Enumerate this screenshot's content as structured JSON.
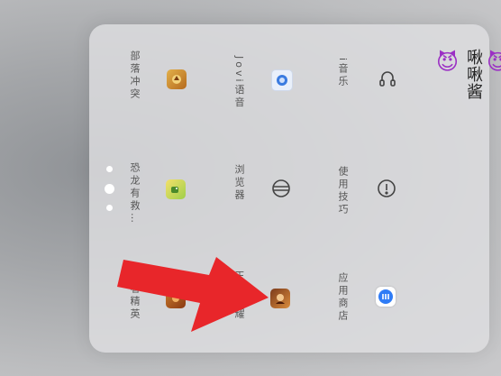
{
  "folder": {
    "title_emoji_left": "😈",
    "title_text": "啾啾酱",
    "title_emoji_right": "😈"
  },
  "apps": [
    {
      "label": "i音乐",
      "icon": "headphones-icon"
    },
    {
      "label": "Jovi语音",
      "icon": "jovi-voice-icon"
    },
    {
      "label": "部落冲突",
      "icon": "clash-of-clans-icon"
    },
    {
      "label": "使用技巧",
      "icon": "tips-icon"
    },
    {
      "label": "浏览器",
      "icon": "browser-icon"
    },
    {
      "label": "恐龙有救…",
      "icon": "dino-game-icon"
    },
    {
      "label": "应用商店",
      "icon": "app-store-icon"
    },
    {
      "label": "王者荣耀",
      "icon": "honor-of-kings-icon"
    },
    {
      "label": "王者精英",
      "icon": "game-icon"
    }
  ],
  "page_indicator": {
    "pages": 3,
    "current": 2
  },
  "colors": {
    "arrow": "#e8262a",
    "panel": "#dedee0",
    "app_store_blue": "#2f7cf6"
  }
}
